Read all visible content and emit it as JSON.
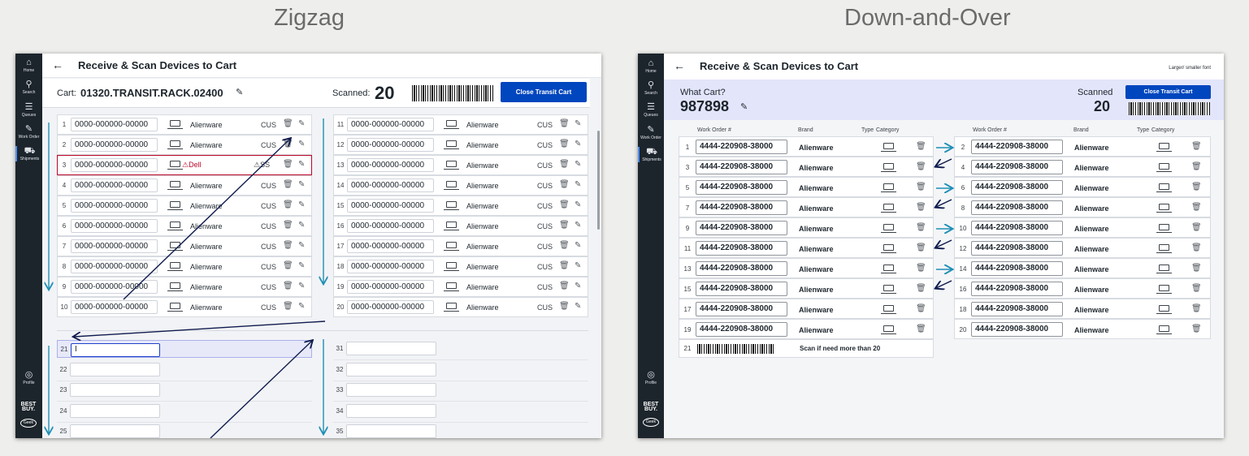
{
  "captions": {
    "left": "Zigzag",
    "right": "Down-and-Over"
  },
  "nav": {
    "items": [
      "Home",
      "Search",
      "Queues",
      "Work Order",
      "Shipments"
    ],
    "profile": "Profile",
    "logo_text": "BEST BUY.",
    "geek_text": "Geek"
  },
  "zigzag": {
    "title": "Receive & Scan Devices to Cart",
    "cart_label": "Cart:",
    "cart_id": "01320.TRANSIT.RACK.02400",
    "scanned_label": "Scanned:",
    "scanned_count": "20",
    "close_button": "Close Transit Cart",
    "wo": "0000-000000-00000",
    "brand": "Alienware",
    "type": "CUS",
    "error_row": {
      "num": "3",
      "wo": "0000-000000-00000",
      "brand": "Dell",
      "type": "SS"
    },
    "input_value": "I"
  },
  "downover": {
    "title": "Receive & Scan Devices to Cart",
    "font_toggle": "Larger/ smaller font",
    "what_cart": "What Cart?",
    "cart_id": "987898",
    "scanned_label": "Scanned",
    "scanned_count": "20",
    "close_button": "Close Transit Cart",
    "headers": {
      "wo": "Work Order #",
      "brand": "Brand",
      "type": "Type",
      "category": "Category"
    },
    "wo": "4444-220908-38000",
    "brand": "Alienware",
    "footer_num": "21",
    "footer_text": "Scan if need more than 20"
  }
}
